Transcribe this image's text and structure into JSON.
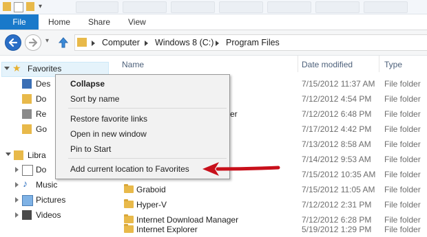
{
  "ribbon": {
    "file": "File",
    "tabs": [
      "Home",
      "Share",
      "View"
    ]
  },
  "address": {
    "segments": [
      "Computer",
      "Windows 8 (C:)",
      "Program Files"
    ]
  },
  "nav": {
    "favorites": "Favorites",
    "fav_items": [
      "Des",
      "Do",
      "Re",
      "Go"
    ],
    "libraries": "Libra",
    "lib_items": [
      "Do",
      "Music",
      "Pictures",
      "Videos"
    ]
  },
  "columns": {
    "name": "Name",
    "date": "Date modified",
    "type": "Type"
  },
  "files": [
    {
      "name": "",
      "date": "7/15/2012 11:37 AM",
      "type": "File folder"
    },
    {
      "name": "",
      "date": "7/12/2012 4:54 PM",
      "type": "File folder"
    },
    {
      "name": "er",
      "date": "7/12/2012 6:48 PM",
      "type": "File folder"
    },
    {
      "name": "",
      "date": "7/17/2012 4:42 PM",
      "type": "File folder"
    },
    {
      "name": "",
      "date": "7/13/2012 8:58 AM",
      "type": "File folder"
    },
    {
      "name": "",
      "date": "7/14/2012 9:53 AM",
      "type": "File folder"
    },
    {
      "name": "",
      "date": "7/15/2012 10:35 AM",
      "type": "File folder"
    },
    {
      "name": "Graboid",
      "date": "7/15/2012 11:05 AM",
      "type": "File folder"
    },
    {
      "name": "Hyper-V",
      "date": "7/12/2012 2:31 PM",
      "type": "File folder"
    },
    {
      "name": "Internet Download Manager",
      "date": "7/12/2012 6:28 PM",
      "type": "File folder"
    },
    {
      "name": "Internet Explorer",
      "date": "5/19/2012 1:29 PM",
      "type": "File folder"
    }
  ],
  "context_menu": {
    "collapse": "Collapse",
    "sort": "Sort by name",
    "restore": "Restore favorite links",
    "open_new": "Open in new window",
    "pin": "Pin to Start",
    "add_current": "Add current location to Favorites"
  },
  "colors": {
    "accent": "#1979ca",
    "arrow": "#c8101b"
  }
}
